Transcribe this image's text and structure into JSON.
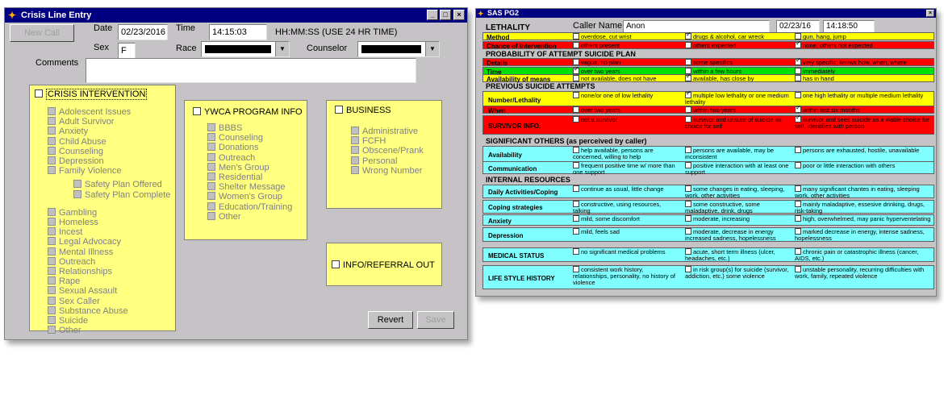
{
  "win1": {
    "title": "Crisis Line Entry",
    "controls": [
      "_",
      "□",
      "×"
    ],
    "new_call": "New Call",
    "date_label": "Date",
    "date_value": "02/23/2016",
    "time_label": "Time",
    "time_value": "14:15:03",
    "time_hint": "HH:MM:SS   (USE 24 HR TIME)",
    "sex_label": "Sex",
    "sex_value": "F",
    "race_label": "Race",
    "counselor_label": "Counselor",
    "comments_label": "Comments",
    "crisis": {
      "title": "CRISIS INTERVENTION",
      "items": [
        "Adolescent Issues",
        "Adult Survivor",
        "Anxiety",
        "Child Abuse",
        "Counseling",
        "Depression",
        "Family Violence"
      ],
      "sub_items": [
        "Safety Plan Offered",
        "Safety Plan Complete"
      ],
      "items2": [
        "Gambling",
        "Homeless",
        "Incest",
        "Legal Advocacy",
        "Mental Illness",
        "Outreach",
        "Relationships",
        "Rape",
        "Sexual Assault",
        "Sex Caller",
        "Substance Abuse",
        "Suicide",
        "Other"
      ]
    },
    "ywca": {
      "title": "YWCA PROGRAM INFO",
      "items": [
        "BBBS",
        "Counseling",
        "Donations",
        "Outreach",
        "Men's Group",
        "Residential",
        "Shelter Message",
        "Women's Group",
        "Education/Training",
        "Other"
      ]
    },
    "business": {
      "title": "BUSINESS",
      "items": [
        "Administrative",
        "FCFH",
        "Obscene/Prank",
        "Personal",
        "Wrong Number"
      ]
    },
    "info_referral": "INFO/REFERRAL OUT",
    "revert": "Revert",
    "save": "Save"
  },
  "win2": {
    "title": "SAS PG2",
    "close": "×",
    "lethality": "LETHALITY",
    "caller_label": "Caller Name",
    "caller_value": "Anon",
    "date_value": "02/23/16",
    "time_value": "14:18:50",
    "sec_prob": "PROBABILITY OF ATTEMPT    SUICIDE PLAN",
    "sec_prev": "PREVIOUS SUICIDE ATTEMPTS",
    "sec_sig": "SIGNIFICANT OTHERS (as perceived by caller)",
    "sec_int": "INTERNAL RESOURCES",
    "rows": [
      {
        "label": "Method",
        "color": "#ffff00",
        "opts": [
          [
            "overdose, cut wrist",
            false
          ],
          [
            "drugs & alcohol, car wreck",
            true
          ],
          [
            "gun, hang, jump",
            false
          ]
        ]
      },
      {
        "label": "Chance of intervention",
        "color": "#ff0000",
        "opts": [
          [
            "others present",
            false
          ],
          [
            "others expected",
            false
          ],
          [
            "none, others not expected",
            true
          ]
        ]
      },
      {
        "label": "Details",
        "color": "#ff0000",
        "opts": [
          [
            "vague, no plan",
            false
          ],
          [
            "some specifics",
            false
          ],
          [
            "very specific, knows how, when, where",
            true
          ]
        ]
      },
      {
        "label": "Time",
        "color": "#00e000",
        "opts": [
          [
            "over two years",
            true
          ],
          [
            "within a few hours",
            false
          ],
          [
            "immediately",
            false
          ]
        ]
      },
      {
        "label": "Availability of means",
        "color": "#ffff00",
        "opts": [
          [
            "not available, does not have",
            false
          ],
          [
            "available, has close by",
            true
          ],
          [
            "has in hand",
            false
          ]
        ]
      },
      {
        "label": "Number/Lethality",
        "color": "#ffff00",
        "opts": [
          [
            "none/or one of low lethality",
            false
          ],
          [
            "multiple low lethality or one medium lethality",
            true
          ],
          [
            "one high lethality or multiple medium lethality",
            false
          ]
        ]
      },
      {
        "label": "When",
        "color": "#ff0000",
        "opts": [
          [
            "over two years",
            false
          ],
          [
            "within two years",
            false
          ],
          [
            "within last six months",
            true
          ]
        ]
      },
      {
        "label": "SURVIVOR INFO.",
        "color": "#ff0000",
        "opts": [
          [
            "not a survivor",
            false
          ],
          [
            "survivor and unsure of suicide as choice for self",
            false
          ],
          [
            "survivor and sees suicide as a viable choice for self, identifies with person",
            true
          ]
        ]
      },
      {
        "label": "Availability",
        "color": "#7fffff",
        "opts": [
          [
            "help available, persons are concerned, willing to help",
            false
          ],
          [
            "persons are available, may be inconsistent",
            false
          ],
          [
            "persons are exhausted, hostile, unavailable",
            false
          ]
        ]
      },
      {
        "label": "Communication",
        "color": "#7fffff",
        "opts": [
          [
            "frequent positive time w/ more than one support",
            false
          ],
          [
            "positive interaction with at least one support",
            false
          ],
          [
            "poor or little interaction with others",
            false
          ]
        ]
      },
      {
        "label": "Daily Activities/Coping",
        "color": "#7fffff",
        "opts": [
          [
            "continue as usual, little change",
            false
          ],
          [
            "some changes in eating, sleeping, work, other activities",
            false
          ],
          [
            "many significant chantes in eating, sleeping work, other activities",
            false
          ]
        ]
      },
      {
        "label": "Coping strategies",
        "color": "#7fffff",
        "opts": [
          [
            "constructive, using resources, talking",
            false
          ],
          [
            "some constructive, some maladaptive, drink, drugs",
            false
          ],
          [
            "mainly maladaptive, essesive drinking, drugs, risk-taking",
            false
          ]
        ]
      },
      {
        "label": "Anxiety",
        "color": "#7fffff",
        "opts": [
          [
            "mild, some discomfort",
            false
          ],
          [
            "moderate, increasing",
            false
          ],
          [
            "high, overwhelmed, may panic hyperventelating",
            false
          ]
        ]
      },
      {
        "label": "Depression",
        "color": "#7fffff",
        "opts": [
          [
            "mild, feels sad",
            false
          ],
          [
            "moderate, decrease in energy increased sadness, hopelessness",
            false
          ],
          [
            "marked decrease in energy, intense sadness, hopelessness",
            false
          ]
        ]
      },
      {
        "label": "MEDICAL STATUS",
        "color": "#7fffff",
        "opts": [
          [
            "no significant medical problems",
            false
          ],
          [
            "acute, short term illness (ulcer, headaches, etc.)",
            false
          ],
          [
            "chronic pain or catastrophic illness (cancer, AIDS, etc.)",
            false
          ]
        ]
      },
      {
        "label": "LIFE STYLE HISTORY",
        "color": "#7fffff",
        "opts": [
          [
            "consistent work history, relationships, personality, no history of violence",
            false
          ],
          [
            "in risk group(s) for suicide (survivor, addiction, etc.) some violence",
            false
          ],
          [
            "unstable personality, recurring difficulties with work, family, repeated violence",
            false
          ]
        ]
      }
    ]
  }
}
